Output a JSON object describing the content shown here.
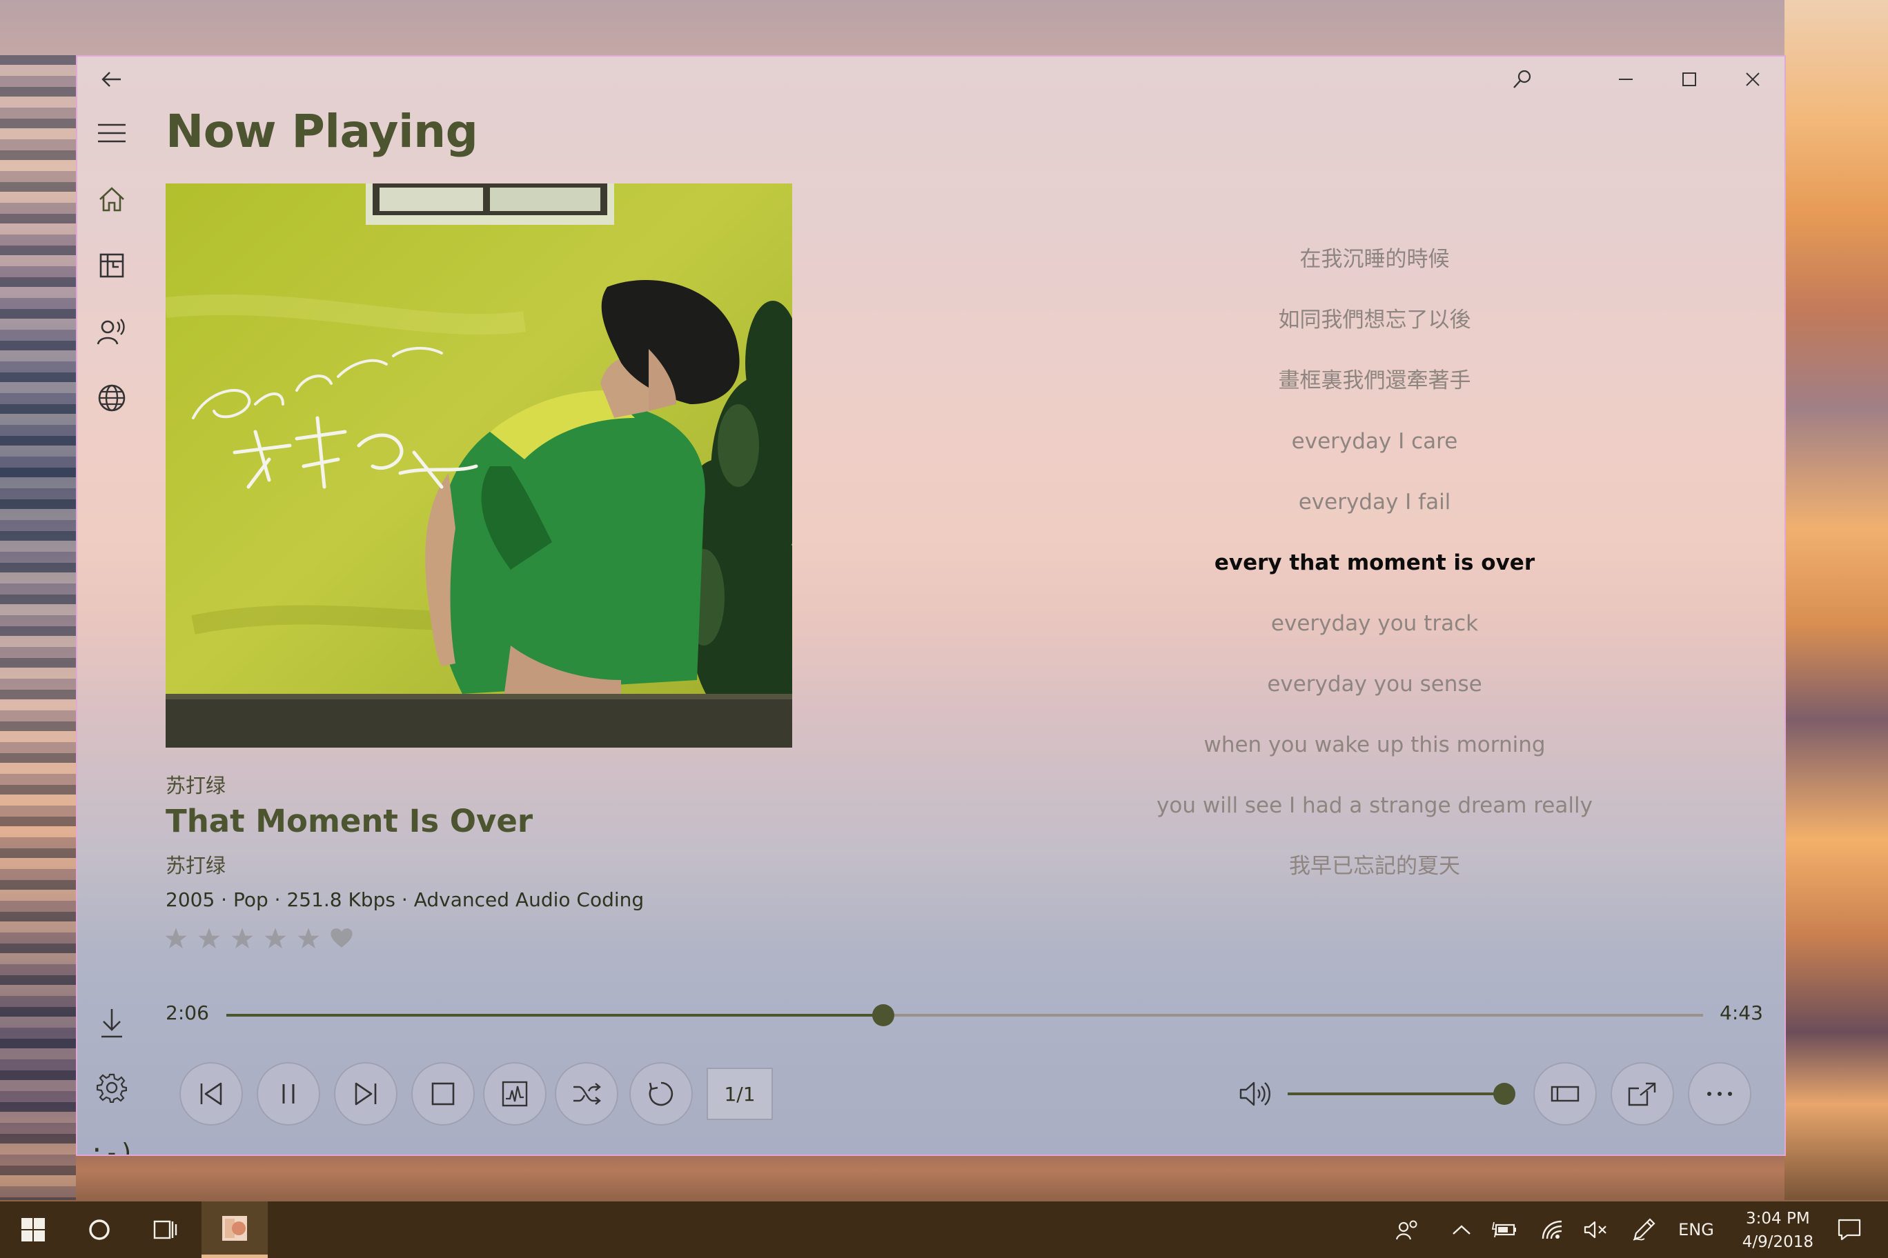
{
  "app": {
    "page_title": "Now Playing"
  },
  "track": {
    "artist": "苏打绿",
    "title": "That Moment Is Over",
    "album": "苏打绿",
    "info": "2005 · Pop · 251.8 Kbps · Advanced Audio Coding",
    "rating_stars": 5,
    "rating_value": 0,
    "favorite": false,
    "album_art_text": {
      "band_latin": "Sodagreen",
      "band_cjk": "蘇打綠"
    }
  },
  "lyrics": {
    "lines": [
      "在我沉睡的時候",
      "如同我們想忘了以後",
      "畫框裏我們還牽著手",
      "everyday I care",
      "everyday I fail",
      "every that moment is over",
      "everyday you track",
      "everyday you sense",
      "when you wake up this morning",
      "you will see I had a strange dream really",
      "我早已忘記的夏天"
    ],
    "active_index": 5
  },
  "playback": {
    "elapsed": "2:06",
    "total": "4:43",
    "progress": 0.445,
    "volume": 1.0,
    "queue_position": "1/1"
  },
  "taskbar": {
    "language": "ENG",
    "time": "3:04 PM",
    "date": "4/9/2018"
  },
  "colors": {
    "accent": "#4d5530",
    "lyric_inactive": "#8e8580",
    "lyric_active": "#0c0c0c",
    "window_border": "#e2a8d8",
    "taskbar": "#3f2c16"
  },
  "icons": {
    "titlebar": [
      "back-arrow-icon",
      "search-icon",
      "minimize-icon",
      "maximize-icon",
      "close-icon"
    ],
    "nav": [
      "hamburger-menu-icon",
      "home-icon",
      "library-icon",
      "artists-icon",
      "globe-icon",
      "download-icon",
      "settings-icon",
      "emoticon-icon"
    ],
    "controls": [
      "previous-icon",
      "pause-icon",
      "next-icon",
      "stop-icon",
      "visualizer-icon",
      "shuffle-icon",
      "repeat-icon",
      "volume-icon",
      "compact-view-icon",
      "share-icon",
      "more-icon"
    ]
  }
}
